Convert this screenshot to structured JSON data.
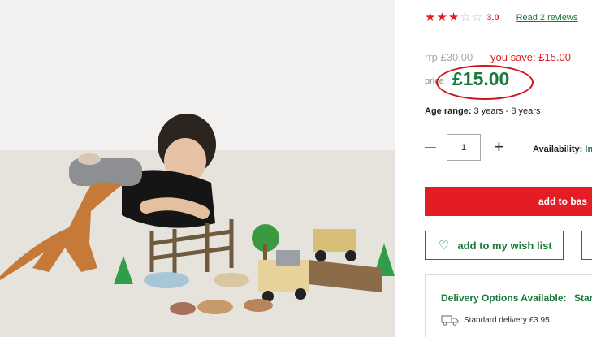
{
  "product": {
    "rating": {
      "stars_filled": 3,
      "stars_total": 5,
      "value": "3.0",
      "reviews_link": "Read 2 reviews"
    },
    "pricing": {
      "rrp": "rrp £30.00",
      "you_save": "you save: £15.00",
      "price_label": "price",
      "price": "£15.00"
    },
    "age_range": {
      "label": "Age range:",
      "value": "3 years - 8 years"
    },
    "quantity": {
      "minus": "—",
      "value": "1",
      "plus": "+"
    },
    "availability": {
      "label": "Availability:",
      "value": "In"
    },
    "actions": {
      "add_to_basket": "add to bas",
      "wish_list": "add to my wish list"
    },
    "delivery": {
      "title": "Delivery Options Available:",
      "title_cont": "Star",
      "standard": "Standard delivery £3.95"
    }
  },
  "colors": {
    "accent_red": "#e41c23",
    "brand_green": "#1b7a3b",
    "annotation_circle": "#d0141c"
  },
  "icons": [
    "star-icon",
    "heart-icon",
    "delivery-truck-icon"
  ]
}
